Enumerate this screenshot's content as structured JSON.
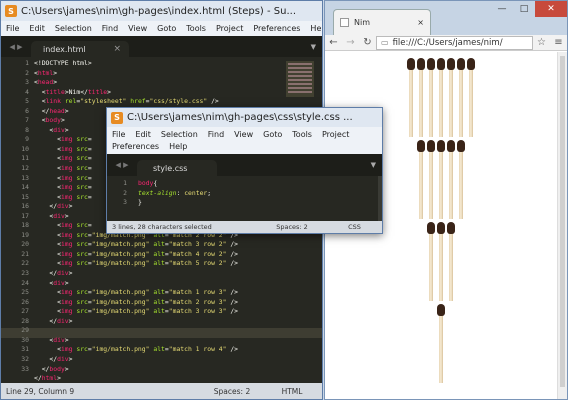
{
  "sublime_main": {
    "title": "C:\\Users\\james\\nim\\gh-pages\\index.html (Steps) - Su...",
    "menu": [
      "File",
      "Edit",
      "Selection",
      "Find",
      "View",
      "Goto",
      "Tools",
      "Project",
      "Preferences",
      "Help"
    ],
    "tab_label": "index.html",
    "line_numbers": [
      "1",
      "2",
      "3",
      "4",
      "5",
      "6",
      "7",
      "8",
      "9",
      "10",
      "11",
      "12",
      "13",
      "14",
      "15",
      "16",
      "17",
      "18",
      "19",
      "20",
      "21",
      "22",
      "23",
      "24",
      "25",
      "26",
      "27",
      "28",
      "29",
      "30",
      "31",
      "32",
      "33"
    ],
    "status_position": "Line 29, Column 9",
    "status_spaces": "Spaces: 2",
    "status_syntax": "HTML"
  },
  "sublime_css": {
    "title": "C:\\Users\\james\\nim\\gh-pages\\css\\style.css ...",
    "menu_row1": [
      "File",
      "Edit",
      "Selection",
      "Find",
      "View",
      "Goto",
      "Tools",
      "Project"
    ],
    "menu_row2": [
      "Preferences",
      "Help"
    ],
    "tab_label": "style.css",
    "line_numbers": [
      "1",
      "2",
      "3"
    ],
    "status_selection": "3 lines, 28 characters selected",
    "status_spaces": "Spaces: 2",
    "status_syntax": "CSS"
  },
  "chrome": {
    "tab_title": "Nim",
    "url": "file:///C:/Users/james/nim/",
    "rows": [
      7,
      5,
      3,
      1
    ]
  },
  "icons": [
    "sublime-app-icon",
    "back-arrow-icon",
    "forward-arrow-icon",
    "reload-icon",
    "page-icon",
    "star-icon",
    "menu-icon",
    "close-icon",
    "minimize-icon",
    "maximize-icon"
  ]
}
